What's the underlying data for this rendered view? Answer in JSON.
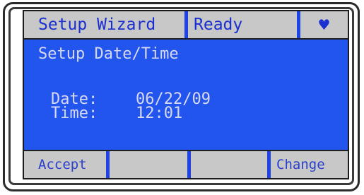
{
  "colors": {
    "screen_background": "#2255ee",
    "bar_background": "#c8c8c8",
    "bar_text": "#1a2fd0",
    "content_text": "#d8d8f0"
  },
  "header": {
    "wizard_label": "Setup Wizard",
    "status": "Ready",
    "icon": "heart-icon",
    "icon_glyph": "♥"
  },
  "main": {
    "title": "Setup Date/Time",
    "date_label": "Date:",
    "date_value": "06/22/09",
    "time_label": "Time:",
    "time_value": "12:01"
  },
  "softkeys": {
    "left": "Accept",
    "middle_left": "",
    "middle_right": "",
    "right": "Change"
  }
}
